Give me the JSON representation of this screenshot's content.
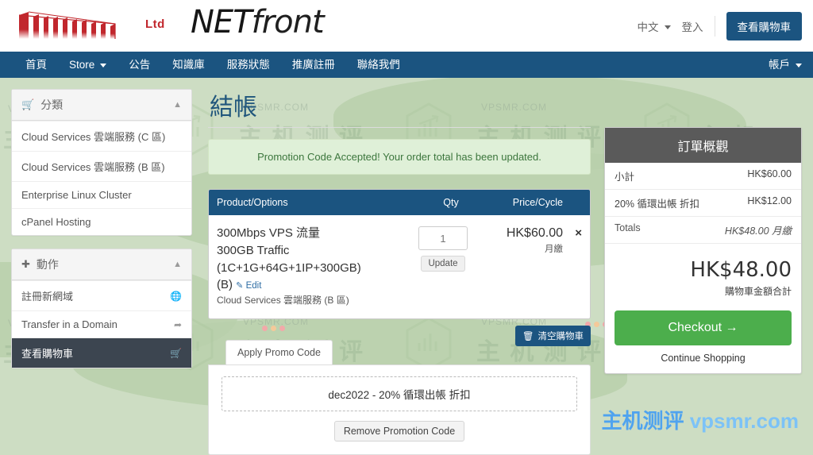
{
  "header": {
    "logo_name": "netfront-logo",
    "ltd": "Ltd",
    "brand_net": "NET",
    "brand_front": "front",
    "language": "中文",
    "login": "登入",
    "cart_button": "查看購物車"
  },
  "nav": {
    "items": [
      {
        "label": "首頁",
        "has_caret": false
      },
      {
        "label": "Store",
        "has_caret": true
      },
      {
        "label": "公告",
        "has_caret": false
      },
      {
        "label": "知識庫",
        "has_caret": false
      },
      {
        "label": "服務狀態",
        "has_caret": false
      },
      {
        "label": "推廣註冊",
        "has_caret": false
      },
      {
        "label": "聯絡我們",
        "has_caret": false
      }
    ],
    "account": "帳戶"
  },
  "sidebar": {
    "categories": {
      "title": "分類",
      "items": [
        "Cloud Services 雲端服務 (C 區)",
        "Cloud Services 雲端服務 (B 區)",
        "Enterprise Linux Cluster",
        "cPanel Hosting"
      ]
    },
    "actions": {
      "title": "動作",
      "items": [
        {
          "label": "註冊新網域",
          "icon": "globe-icon",
          "active": false
        },
        {
          "label": "Transfer in a Domain",
          "icon": "transfer-icon",
          "active": false
        },
        {
          "label": "查看購物車",
          "icon": "cart-icon",
          "active": true
        }
      ]
    }
  },
  "main": {
    "page_title": "結帳",
    "alert": "Promotion Code Accepted! Your order total has been updated.",
    "table": {
      "headers": [
        "Product/Options",
        "Qty",
        "Price/Cycle"
      ],
      "rows": [
        {
          "product_line1": "300Mbps VPS 流量",
          "product_line2": "300GB Traffic",
          "product_line3": "(1C+1G+64G+1IP+300GB)",
          "product_line4": "(B)",
          "edit_label": "Edit",
          "product_sub": "Cloud Services 雲端服務 (B 區)",
          "qty": "1",
          "update_label": "Update",
          "price": "HK$60.00",
          "cycle": "月繳",
          "remove": "×"
        }
      ]
    },
    "empty_cart_button": "清空購物車",
    "promo": {
      "tab_label": "Apply Promo Code",
      "applied_code": "dec2022 - 20% 循環出帳 折扣",
      "remove_label": "Remove Promotion Code"
    }
  },
  "summary": {
    "title": "訂單概觀",
    "rows": [
      {
        "label": "小計",
        "value": "HK$60.00"
      },
      {
        "label": "20% 循環出帳 折扣",
        "value": "HK$12.00"
      },
      {
        "label": "Totals",
        "value": "HK$48.00 月繳"
      }
    ],
    "total_amount": "HK$48.00",
    "total_label": "購物車金額合計",
    "checkout_label": "Checkout",
    "checkout_arrow": "→",
    "continue_label": "Continue Shopping"
  },
  "watermark": {
    "bottom_cn": "主机测评",
    "bottom_en": "vpsmr.com",
    "tile_cn": "主 机 测 评",
    "tile_en": "VPSMR.COM"
  },
  "colors": {
    "nav_blue": "#1b5480",
    "table_head_blue": "#1b5480",
    "checkout_green": "#4cae4c",
    "alert_green_bg": "#dff0d8",
    "summary_head_gray": "#5a5a5a",
    "logo_red": "#c1272d",
    "page_bg_green": "#cdddc3",
    "sidebar_active": "#3c4550"
  }
}
